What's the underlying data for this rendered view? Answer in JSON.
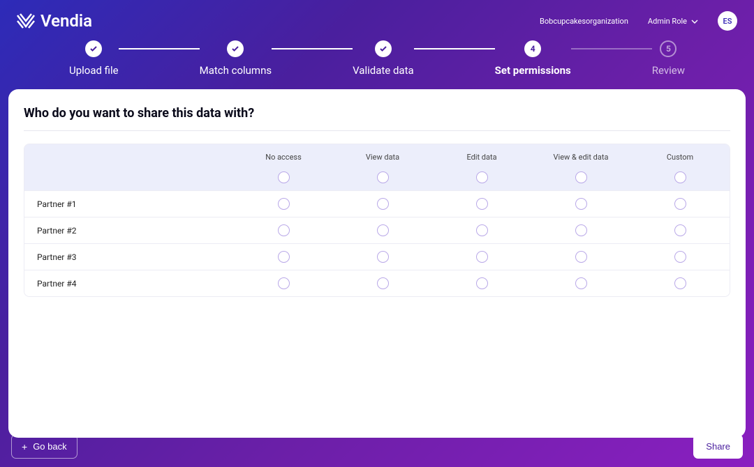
{
  "brand": "Vendia",
  "org_name": "Bobcupcakesorganization",
  "role_label": "Admin Role",
  "avatar_initials": "ES",
  "steps": [
    {
      "label": "Upload file"
    },
    {
      "label": "Match columns"
    },
    {
      "label": "Validate data"
    },
    {
      "label": "Set permissions",
      "number": "4"
    },
    {
      "label": "Review",
      "number": "5"
    }
  ],
  "panel": {
    "title": "Who do you want to share this data with?",
    "columns": [
      "No access",
      "View data",
      "Edit data",
      "View & edit data",
      "Custom"
    ],
    "rows": [
      "Partner #1",
      "Partner #2",
      "Partner #3",
      "Partner #4"
    ]
  },
  "footer": {
    "back_label": "Go back",
    "share_label": "Share"
  }
}
